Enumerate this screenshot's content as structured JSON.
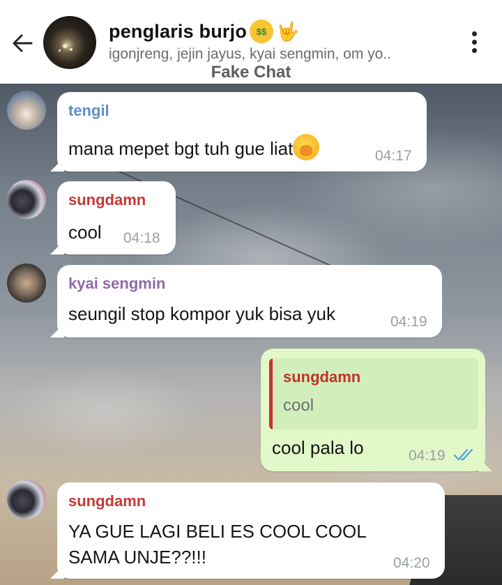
{
  "header": {
    "title": "penglaris burjo",
    "title_emojis": [
      "money-mouth-face",
      "sign-of-the-horns"
    ],
    "members": "igonjreng, jejin jayus, kyai sengmin, om yo..",
    "watermark": "Fake Chat"
  },
  "messages": [
    {
      "sender": "tengil",
      "sender_color": "#5b8fca",
      "text": "mana mepet bgt tuh gue liat",
      "trailing_emoji": "face-with-hand-over-mouth",
      "time": "04:17"
    },
    {
      "sender": "sungdamn",
      "sender_color": "#c33a33",
      "text": "cool",
      "time": "04:18"
    },
    {
      "sender": "kyai sengmin",
      "sender_color": "#9069a8",
      "text": "seungil stop kompor yuk bisa yuk",
      "time": "04:19"
    },
    {
      "outgoing": true,
      "reply_to": {
        "sender": "sungdamn",
        "text": "cool"
      },
      "text": "cool pala lo",
      "time": "04:19",
      "status": "read"
    },
    {
      "sender": "sungdamn",
      "sender_color": "#c33a33",
      "text_lines": [
        "YA GUE LAGI BELI ES COOL COOL",
        "SAMA UNJE??!!!"
      ],
      "time": "04:20"
    }
  ],
  "colors": {
    "outgoing_bubble": "#e2f8c9",
    "incoming_bubble": "#ffffff",
    "read_ticks": "#4aa3df"
  }
}
